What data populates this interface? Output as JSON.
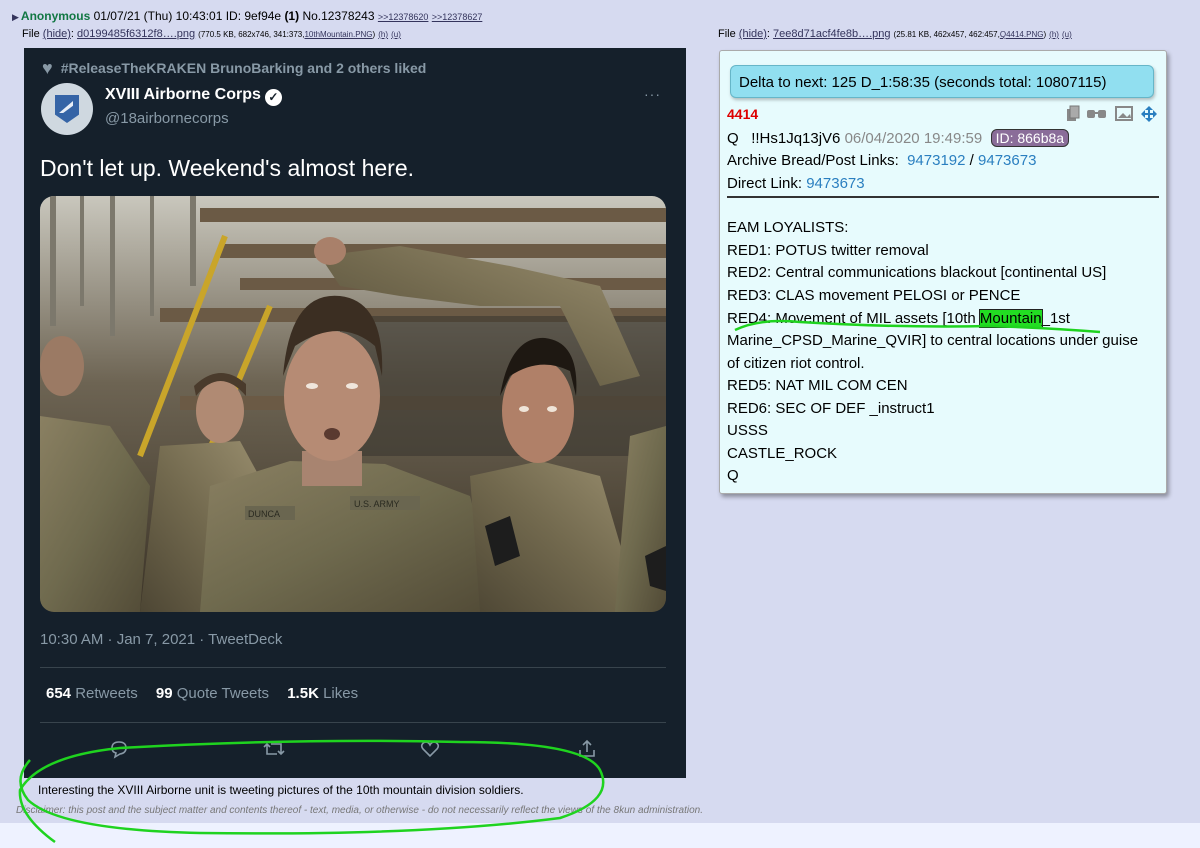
{
  "post": {
    "name": "Anonymous",
    "datetime": "01/07/21 (Thu) 10:43:01",
    "id_label": "ID: 9ef94e",
    "id_count": "(1)",
    "number": "No.12378243",
    "backlinks": [
      ">>12378620",
      ">>12378627"
    ]
  },
  "file1": {
    "prefix": "File",
    "hide": "(hide)",
    "name": "d0199485f6312f8….png",
    "meta": "(770.5 KB, 682x746, 341:373,",
    "orig": "10thMountain.PNG",
    "close": ")",
    "h": "(h)",
    "u": "(u)"
  },
  "file2": {
    "prefix": "File",
    "hide": "(hide)",
    "name": "7ee8d71acf4fe8b….png",
    "meta": "(25.81 KB, 462x457, 462:457,",
    "orig": "Q4414.PNG",
    "close": ")",
    "h": "(h)",
    "u": "(u)"
  },
  "tweet": {
    "liked_by": "#ReleaseTheKRAKEN BrunoBarking and 2 others liked",
    "display_name": "XVIII Airborne Corps",
    "handle": "@18airbornecorps",
    "more": "···",
    "text": "Don't let up. Weekend's almost here.",
    "time": "10:30 AM · Jan 7, 2021 · TweetDeck",
    "retweets_count": "654",
    "retweets_label": "Retweets",
    "quotes_count": "99",
    "quotes_label": "Quote Tweets",
    "likes_count": "1.5K",
    "likes_label": "Likes",
    "photo_name_tag": "DUNCA",
    "photo_army_tag": "U.S. ARMY"
  },
  "caption": "Interesting the XVIII Airborne unit is tweeting pictures of the 10th mountain division soldiers.",
  "disclaimer": "Disclaimer: this post and the subject matter and contents thereof - text, media, or otherwise - do not necessarily reflect the views of the 8kun administration.",
  "qpost": {
    "delta": "Delta to next:   125 D_1:58:35  (seconds total: 10807115)",
    "number": "4414",
    "author": "Q",
    "trip": "!!Hs1Jq13jV6",
    "date": "06/04/2020 19:49:59",
    "id": "ID: 866b8a",
    "archive_label": "Archive Bread/Post Links:",
    "archive_link1": "9473192",
    "archive_sep": "/",
    "archive_link2": "9473673",
    "direct_label": "Direct Link:",
    "direct_link": "9473673",
    "body": [
      "EAM LOYALISTS:",
      "RED1: POTUS twitter removal",
      "RED2: Central communications blackout [continental US]",
      "RED3: CLAS movement PELOSI or PENCE"
    ],
    "red4_pre": "RED4: Movement of MIL assets [10th ",
    "red4_hl": "Mountain",
    "red4_post": "_1st",
    "body2": [
      "Marine_CPSD_Marine_QVIR] to central locations under guise",
      "of citizen riot control.",
      "RED5: NAT MIL COM CEN",
      "RED6: SEC OF DEF _instruct1",
      "USSS",
      "CASTLE_ROCK",
      "Q"
    ]
  }
}
